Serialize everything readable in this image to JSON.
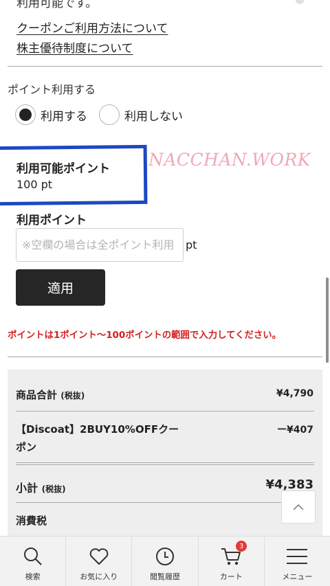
{
  "top_partial_text": "利用可能です。",
  "links": {
    "coupon_usage": "クーポンご利用方法について",
    "shareholder": "株主優待制度について"
  },
  "points": {
    "section_title": "ポイント利用する",
    "radio_use": "利用する",
    "radio_not_use": "利用しない",
    "selected": "利用する",
    "available_label": "利用可能ポイント",
    "available_value": "100 pt",
    "use_label": "利用ポイント",
    "input_placeholder": "※空欄の場合は全ポイント利用",
    "input_value": "",
    "unit": "pt",
    "apply_button": "適用",
    "error_message": "ポイントは1ポイント〜100ポイントの範囲で入力してください。"
  },
  "watermark": "NACCHAN.WORK",
  "summary": {
    "subtotal_items_label": "商品合計",
    "tax_excl": "(税抜)",
    "subtotal_items_value": "¥4,790",
    "coupon_label": "【Discoat】2BUY10%OFFクーポン",
    "coupon_value": "ー¥407",
    "subtotal_label": "小計",
    "subtotal_value": "¥4,383",
    "tax_label": "消費税"
  },
  "bottom_nav": {
    "search": "検索",
    "favorites": "お気に入り",
    "history": "閲覧履歴",
    "cart": "カート",
    "cart_count": "3",
    "menu": "メニュー"
  },
  "colors": {
    "error": "#d51f1f",
    "highlight_box": "#1d48c2",
    "apply_button_bg": "#262626",
    "cart_badge": "#e53935",
    "watermark": "#f0a8b6"
  }
}
